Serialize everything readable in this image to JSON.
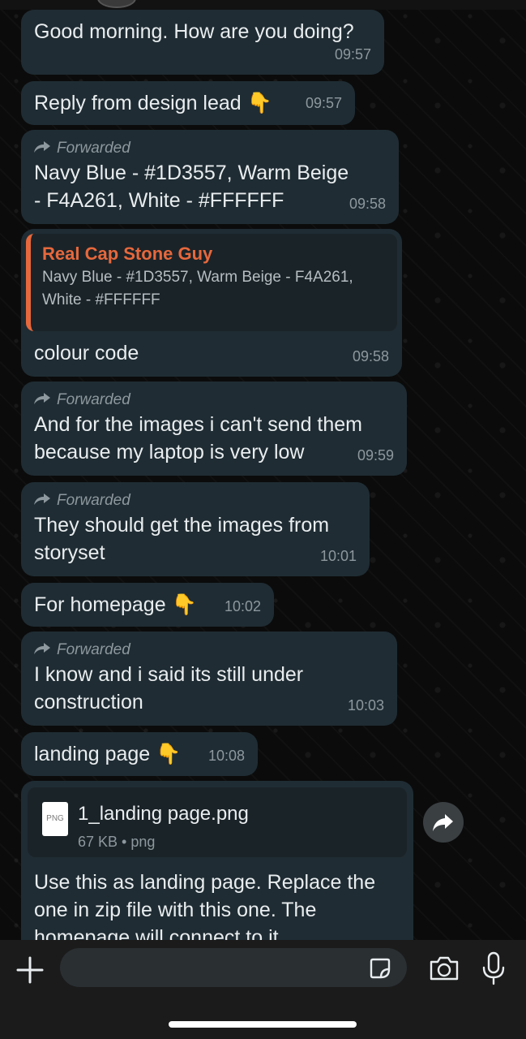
{
  "messages": [
    {
      "text": "Good morning. How are you doing?",
      "time": "09:57"
    },
    {
      "text": "Reply from design lead 👇",
      "time": "09:57"
    },
    {
      "forwarded": "Forwarded",
      "text": "Navy Blue - #1D3557, Warm Beige - F4A261, White - #FFFFFF",
      "time": "09:58"
    },
    {
      "quote_author": "Real Cap Stone Guy",
      "quote_text": "Navy Blue - #1D3557, Warm Beige - F4A261, White - #FFFFFF",
      "text": "colour code",
      "time": "09:58"
    },
    {
      "forwarded": "Forwarded",
      "text": "And for the images i can't send them because my laptop is very low",
      "time": "09:59"
    },
    {
      "forwarded": "Forwarded",
      "text": "They should get the images from storyset",
      "time": "10:01"
    },
    {
      "text": "For homepage 👇",
      "time": "10:02"
    },
    {
      "forwarded": "Forwarded",
      "text": "I know and i said its still under construction",
      "time": "10:03"
    },
    {
      "text": "landing page 👇",
      "time": "10:08"
    },
    {
      "doc_name": "1_landing page.png",
      "doc_meta": "67 KB • png",
      "doc_icon_label": "PNG",
      "text": "Use this as landing page. Replace the one in zip file with this one. The homepage will connect to it"
    }
  ],
  "composer": {
    "placeholder": ""
  },
  "icons": {
    "forward": "forward-arrow-icon",
    "share": "share-forward-icon",
    "plus": "plus-icon",
    "sticker": "sticker-icon",
    "camera": "camera-icon",
    "mic": "microphone-icon"
  },
  "colors": {
    "bubble": "#1f2c33",
    "quote_accent": "#e7683c",
    "meta": "#8d989e"
  }
}
